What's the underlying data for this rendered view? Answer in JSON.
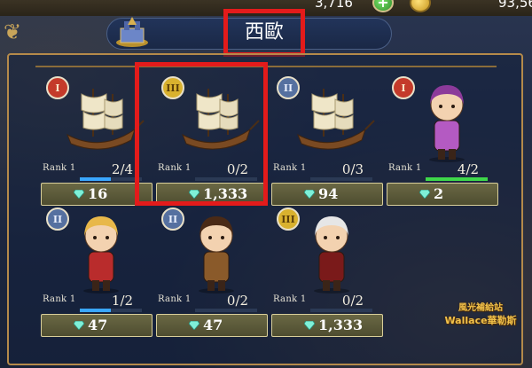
{
  "header": {
    "currency_1": "3,716",
    "currency_2": "93,56",
    "region_title": "西歐"
  },
  "colors": {
    "highlight": "#e31b1b",
    "rank_badge_1": "#c43a2a",
    "rank_badge_2": "#5570a0",
    "rank_badge_3": "#d9b12e",
    "progress_blue": "#3aa7ff",
    "progress_green": "#3ed84a"
  },
  "cards": [
    {
      "tier": "I",
      "rank": "Rank 1",
      "progress": "2/4",
      "progress_fraction": 0.5,
      "progress_color": "blue",
      "cost": "16",
      "art_icon": "ship-icon"
    },
    {
      "tier": "III",
      "rank": "Rank 1",
      "progress": "0/2",
      "progress_fraction": 0.0,
      "progress_color": "blue",
      "cost": "1,333",
      "art_icon": "ship-icon"
    },
    {
      "tier": "II",
      "rank": "Rank 1",
      "progress": "0/3",
      "progress_fraction": 0.0,
      "progress_color": "blue",
      "cost": "94",
      "art_icon": "ship-icon"
    },
    {
      "tier": "I",
      "rank": "Rank 1",
      "progress": "4/2",
      "progress_fraction": 1.0,
      "progress_color": "green",
      "cost": "2",
      "art_icon": "character-icon"
    },
    {
      "tier": "II",
      "rank": "Rank 1",
      "progress": "1/2",
      "progress_fraction": 0.5,
      "progress_color": "blue",
      "cost": "47",
      "art_icon": "character-icon"
    },
    {
      "tier": "II",
      "rank": "Rank 1",
      "progress": "0/2",
      "progress_fraction": 0.0,
      "progress_color": "blue",
      "cost": "47",
      "art_icon": "character-icon"
    },
    {
      "tier": "III",
      "rank": "Rank 1",
      "progress": "0/2",
      "progress_fraction": 0.0,
      "progress_color": "blue",
      "cost": "1,333",
      "art_icon": "character-icon"
    }
  ],
  "watermark": {
    "line1": "風光補給站",
    "line2": "Wallace華勒斯"
  }
}
